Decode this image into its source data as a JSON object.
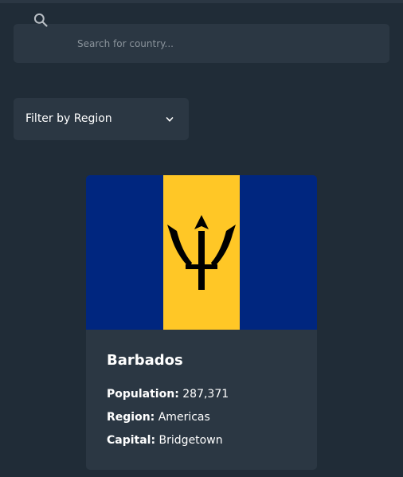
{
  "search": {
    "placeholder": "Search for country...",
    "icon": "search-icon"
  },
  "filter": {
    "label": "Filter by Region",
    "icon": "chevron-down-icon"
  },
  "card": {
    "name": "Barbados",
    "flag_colors": {
      "blue": "#00267f",
      "gold": "#ffc726",
      "trident": "#000000"
    },
    "population_label": "Population:",
    "population_value": "287,371",
    "region_label": "Region:",
    "region_value": "Americas",
    "capital_label": "Capital:",
    "capital_value": "Bridgetown"
  },
  "colors": {
    "background": "#202c37",
    "element": "#2b3743",
    "text": "#ffffff",
    "placeholder": "#8a939b"
  }
}
